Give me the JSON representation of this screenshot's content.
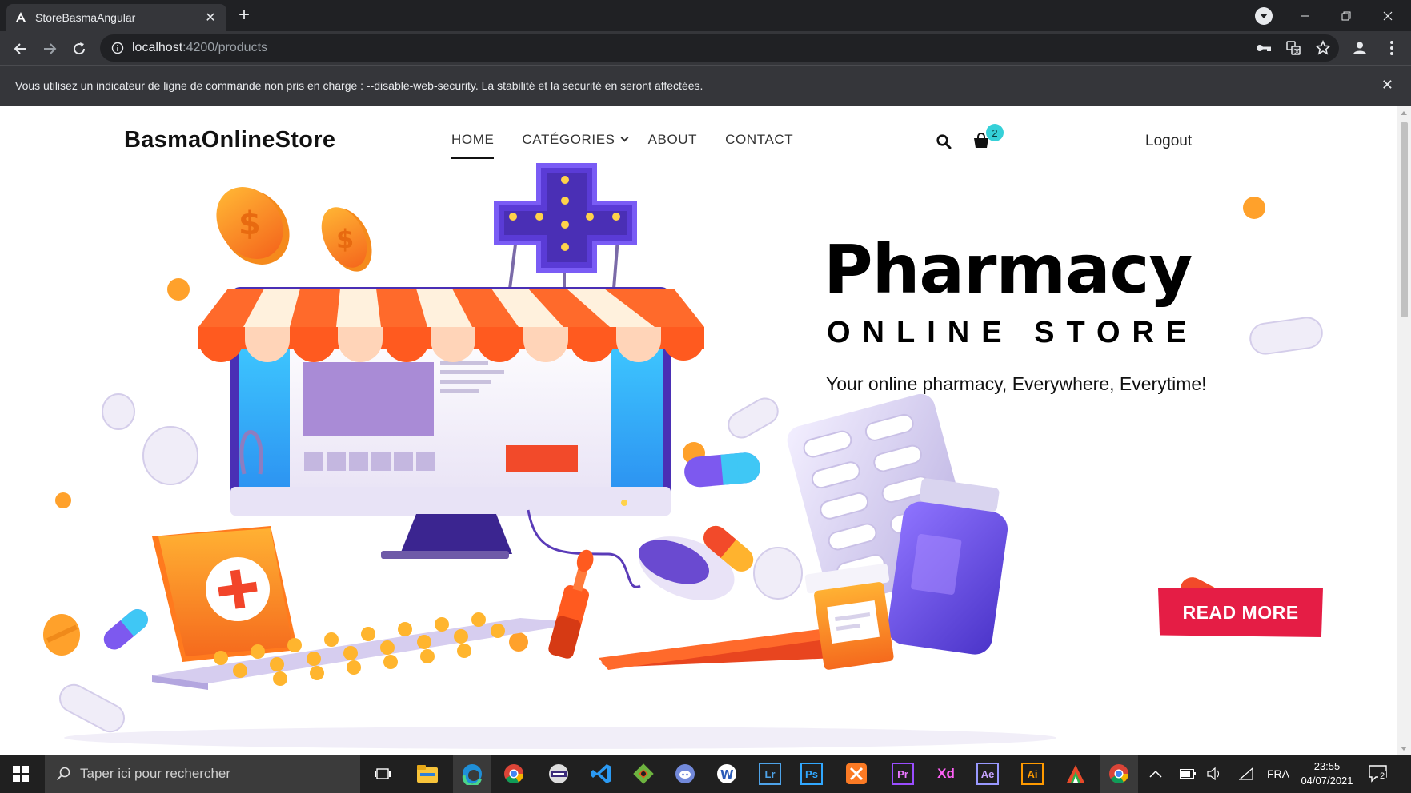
{
  "browser": {
    "tab_title": "StoreBasmaAngular",
    "tab_close": "✕",
    "new_tab": "+",
    "url_host": "localhost",
    "url_path": ":4200/products",
    "infobar_message": "Vous utilisez un indicateur de ligne de commande non pris en charge : --disable-web-security. La stabilité et la sécurité en seront affectées.",
    "infobar_close": "✕"
  },
  "site": {
    "brand": "BasmaOnlineStore",
    "nav": [
      {
        "label": "HOME",
        "active": true
      },
      {
        "label": "CATÉGORIES"
      },
      {
        "label": "ABOUT"
      },
      {
        "label": "CONTACT"
      }
    ],
    "cart_count": "2",
    "logout": "Logout"
  },
  "hero": {
    "title": "Pharmacy",
    "subtitle": "ONLINE STORE",
    "tagline": "Your online pharmacy, Everywhere, Everytime!",
    "cta": "READ MORE"
  },
  "taskbar": {
    "search_placeholder": "Taper ici pour rechercher",
    "apps": [
      "task-view",
      "file-explorer",
      "edge",
      "chrome",
      "terminal",
      "vscode",
      "git",
      "discord",
      "wamp",
      "Lr",
      "Ps",
      "xampp",
      "Pr",
      "Xd",
      "Ae",
      "Ai",
      "app-red",
      "chrome-active"
    ],
    "language": "FRA",
    "time": "23:55",
    "date": "04/07/2021",
    "notifications": "2"
  },
  "colors": {
    "accent_red": "#e51d45",
    "badge_teal": "#35d0d8",
    "chrome_dark": "#202124",
    "chrome_mid": "#35363a"
  }
}
